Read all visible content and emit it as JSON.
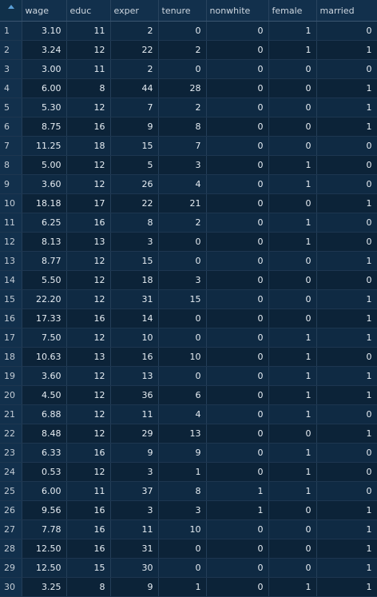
{
  "columns": [
    "wage",
    "educ",
    "exper",
    "tenure",
    "nonwhite",
    "female",
    "married"
  ],
  "rows": [
    [
      "1",
      "3.10",
      "11",
      "2",
      "0",
      "0",
      "1",
      "0"
    ],
    [
      "2",
      "3.24",
      "12",
      "22",
      "2",
      "0",
      "1",
      "1"
    ],
    [
      "3",
      "3.00",
      "11",
      "2",
      "0",
      "0",
      "0",
      "0"
    ],
    [
      "4",
      "6.00",
      "8",
      "44",
      "28",
      "0",
      "0",
      "1"
    ],
    [
      "5",
      "5.30",
      "12",
      "7",
      "2",
      "0",
      "0",
      "1"
    ],
    [
      "6",
      "8.75",
      "16",
      "9",
      "8",
      "0",
      "0",
      "1"
    ],
    [
      "7",
      "11.25",
      "18",
      "15",
      "7",
      "0",
      "0",
      "0"
    ],
    [
      "8",
      "5.00",
      "12",
      "5",
      "3",
      "0",
      "1",
      "0"
    ],
    [
      "9",
      "3.60",
      "12",
      "26",
      "4",
      "0",
      "1",
      "0"
    ],
    [
      "10",
      "18.18",
      "17",
      "22",
      "21",
      "0",
      "0",
      "1"
    ],
    [
      "11",
      "6.25",
      "16",
      "8",
      "2",
      "0",
      "1",
      "0"
    ],
    [
      "12",
      "8.13",
      "13",
      "3",
      "0",
      "0",
      "1",
      "0"
    ],
    [
      "13",
      "8.77",
      "12",
      "15",
      "0",
      "0",
      "0",
      "1"
    ],
    [
      "14",
      "5.50",
      "12",
      "18",
      "3",
      "0",
      "0",
      "0"
    ],
    [
      "15",
      "22.20",
      "12",
      "31",
      "15",
      "0",
      "0",
      "1"
    ],
    [
      "16",
      "17.33",
      "16",
      "14",
      "0",
      "0",
      "0",
      "1"
    ],
    [
      "17",
      "7.50",
      "12",
      "10",
      "0",
      "0",
      "1",
      "1"
    ],
    [
      "18",
      "10.63",
      "13",
      "16",
      "10",
      "0",
      "1",
      "0"
    ],
    [
      "19",
      "3.60",
      "12",
      "13",
      "0",
      "0",
      "1",
      "1"
    ],
    [
      "20",
      "4.50",
      "12",
      "36",
      "6",
      "0",
      "1",
      "1"
    ],
    [
      "21",
      "6.88",
      "12",
      "11",
      "4",
      "0",
      "1",
      "0"
    ],
    [
      "22",
      "8.48",
      "12",
      "29",
      "13",
      "0",
      "0",
      "1"
    ],
    [
      "23",
      "6.33",
      "16",
      "9",
      "9",
      "0",
      "1",
      "0"
    ],
    [
      "24",
      "0.53",
      "12",
      "3",
      "1",
      "0",
      "1",
      "0"
    ],
    [
      "25",
      "6.00",
      "11",
      "37",
      "8",
      "1",
      "1",
      "0"
    ],
    [
      "26",
      "9.56",
      "16",
      "3",
      "3",
      "1",
      "0",
      "1"
    ],
    [
      "27",
      "7.78",
      "16",
      "11",
      "10",
      "0",
      "0",
      "1"
    ],
    [
      "28",
      "12.50",
      "16",
      "31",
      "0",
      "0",
      "0",
      "1"
    ],
    [
      "29",
      "12.50",
      "15",
      "30",
      "0",
      "0",
      "0",
      "1"
    ],
    [
      "30",
      "3.25",
      "8",
      "9",
      "1",
      "0",
      "1",
      "1"
    ]
  ]
}
